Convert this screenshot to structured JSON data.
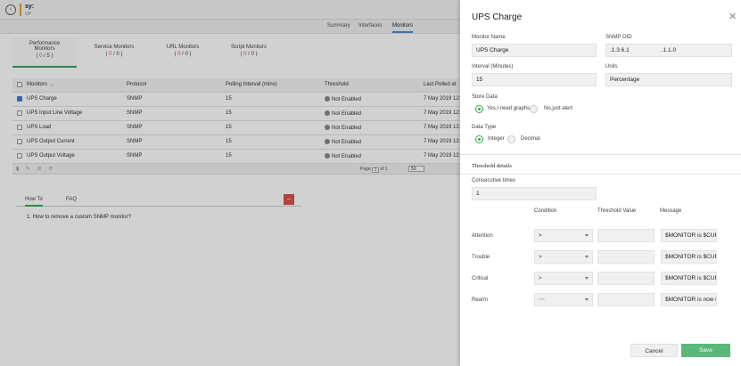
{
  "header": {
    "back_icon": "chevron-left-icon",
    "host_name": "sy:",
    "host_sub": "UP"
  },
  "subnav": [
    "Summary",
    "Interfaces",
    "Monitors"
  ],
  "monitor_tabs": [
    {
      "label_line1": "Performance",
      "label_line2": "Monitors",
      "count_open": "( ",
      "count_a": "0",
      "count_sep": " / ",
      "count_b": "5",
      "count_close": " )"
    },
    {
      "label_line1": "Service Monitors",
      "label_line2": "",
      "count_open": "( ",
      "count_a": "0",
      "count_sep": " / ",
      "count_b": "0",
      "count_close": " )"
    },
    {
      "label_line1": "URL Monitors",
      "label_line2": "",
      "count_open": "( ",
      "count_a": "0",
      "count_sep": " / ",
      "count_b": "0",
      "count_close": " )"
    },
    {
      "label_line1": "Script Monitors",
      "label_line2": "",
      "count_open": "( ",
      "count_a": "0",
      "count_sep": " / ",
      "count_b": "0",
      "count_close": " )"
    }
  ],
  "table": {
    "columns": [
      "Monitors",
      "Protocol",
      "Polling Interval (mins)",
      "Threshold",
      "Last Polled at"
    ],
    "rows": [
      {
        "name": "UPS Charge",
        "protocol": "SNMP",
        "interval": "15",
        "threshold": "Not Enabled",
        "polled": "7 May 2019 12:",
        "checked": true
      },
      {
        "name": "UPS Input Line Voltage",
        "protocol": "SNMP",
        "interval": "15",
        "threshold": "Not Enabled",
        "polled": "7 May 2019 12:",
        "checked": false
      },
      {
        "name": "UPS Load",
        "protocol": "SNMP",
        "interval": "15",
        "threshold": "Not Enabled",
        "polled": "7 May 2019 12:",
        "checked": false
      },
      {
        "name": "UPS Output Current",
        "protocol": "SNMP",
        "interval": "15",
        "threshold": "Not Enabled",
        "polled": "7 May 2019 12:",
        "checked": false
      },
      {
        "name": "UPS Output Voltage",
        "protocol": "SNMP",
        "interval": "15",
        "threshold": "Not Enabled",
        "polled": "7 May 2019 12:",
        "checked": false
      }
    ]
  },
  "pager": {
    "page_label": "Page",
    "page_value": "1",
    "of_label": "of 1",
    "per_page": "50"
  },
  "howto": {
    "tabs": [
      "How To",
      "FAQ"
    ],
    "question": "1. How to remove a custom SNMP monitor?"
  },
  "panel": {
    "title": "UPS Charge",
    "monitor_name_label": "Monitor Name",
    "monitor_name_value": "UPS Charge",
    "snmp_oid_label": "SNMP OID",
    "snmp_oid_value": ".1.3.6.1                    .1.1.0",
    "interval_label": "Interval (Minutes)",
    "interval_value": "15",
    "units_label": "Units",
    "units_value": "Percentage",
    "store_data_label": "Store Data",
    "store_opt1": "Yes,I need graphs",
    "store_opt2": "No,just alert",
    "data_type_label": "Data Type",
    "dtype_opt1": "Integer",
    "dtype_opt2": "Decimal",
    "threshold_heading": "Threshold details",
    "consecutive_label": "Consecutive times",
    "consecutive_value": "1",
    "col_condition": "Condition",
    "col_threshold": "Threshold Value",
    "col_message": "Message",
    "rows": [
      {
        "label": "Attention",
        "condition": ">",
        "message": "$MONITOR is $CURRE"
      },
      {
        "label": "Trouble",
        "condition": ">",
        "message": "$MONITOR is $CURRE"
      },
      {
        "label": "Critical",
        "condition": ">",
        "message": "$MONITOR is $CURRE"
      },
      {
        "label": "Rearm",
        "condition": "<=",
        "message": "$MONITOR is now bac"
      }
    ],
    "cancel_label": "Cancel",
    "save_label": "Save"
  },
  "colors": {
    "accent_green": "#5cb87a",
    "checkbox_blue": "#3b7dd8",
    "alert_red": "#d9534f"
  }
}
